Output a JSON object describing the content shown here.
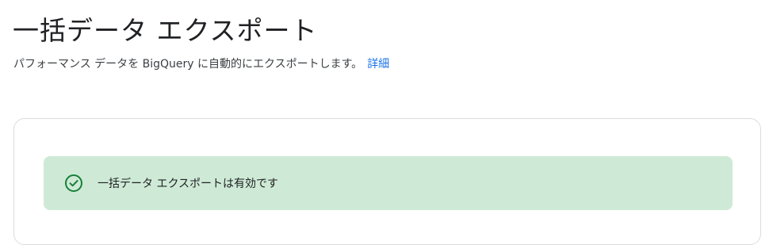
{
  "header": {
    "title": "一括データ エクスポート",
    "description": "パフォーマンス データを BigQuery に自動的にエクスポートします。",
    "learn_more_label": "詳細"
  },
  "status_card": {
    "icon": "check-circle-icon",
    "message": "一括データ エクスポートは有効です",
    "colors": {
      "banner_background": "#ceead6",
      "icon": "#188038",
      "link": "#1a73e8"
    }
  }
}
